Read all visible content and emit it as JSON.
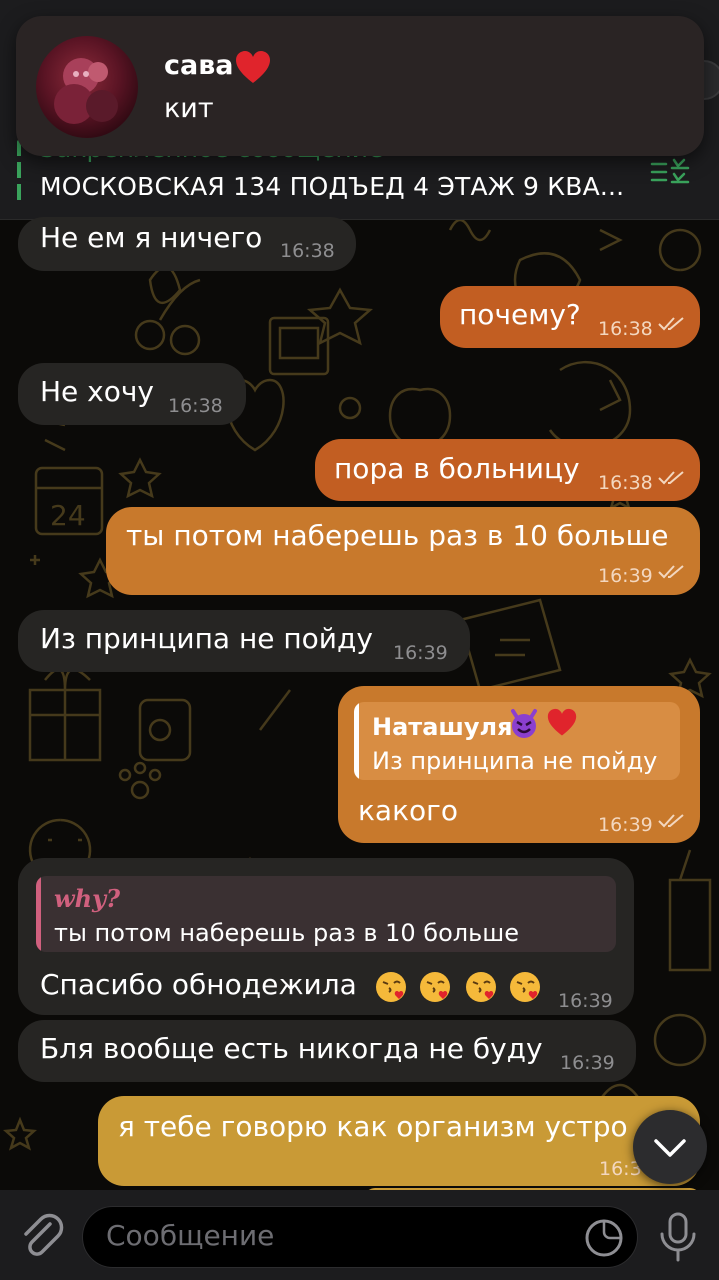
{
  "notification": {
    "title": "сава",
    "body": "кит"
  },
  "pinned": {
    "title": "Закрепленное сообщение",
    "text": "МОСКОВСКАЯ 134 ПОДЪЕД 4 ЭТАЖ 9 КВА..."
  },
  "messages": [
    {
      "direction": "in",
      "text": "Не ем я ничего",
      "time": "16:38"
    },
    {
      "direction": "out",
      "text": "почему?",
      "time": "16:38"
    },
    {
      "direction": "in",
      "text": "Не хочу",
      "time": "16:38"
    },
    {
      "direction": "out",
      "text": "пора в больницу",
      "time": "16:38"
    },
    {
      "direction": "out",
      "text": "ты потом наберешь раз в 10 больше",
      "time": "16:39"
    },
    {
      "direction": "in",
      "text": "Из принципа не пойду",
      "time": "16:39"
    },
    {
      "direction": "out",
      "reply_name": "Наташуля",
      "reply_text": "Из принципа не пойду",
      "text": "какого",
      "time": "16:39"
    },
    {
      "direction": "in",
      "reply_name": "why?",
      "reply_text": "ты потом наберешь раз в 10 больше",
      "text": "Спасибо обнодежила",
      "time": "16:39"
    },
    {
      "direction": "in",
      "text": "Бля вообще есть никогда не буду",
      "time": "16:39"
    },
    {
      "direction": "out",
      "text": "я тебе говорю как организм устро",
      "time": "16:3"
    }
  ],
  "input": {
    "placeholder": "Сообщение"
  },
  "colors": {
    "outgoing_orange": "#c25e22",
    "outgoing_amber": "#c8792c",
    "outgoing_yellow": "#c99a36",
    "incoming": "#262523",
    "pinned_accent": "#3aa35c"
  },
  "icons": [
    "attach-icon",
    "sticker-icon",
    "mic-icon",
    "chevron-down-icon",
    "double-check-icon",
    "heart-icon",
    "devil-emoji",
    "kiss-emoji"
  ]
}
